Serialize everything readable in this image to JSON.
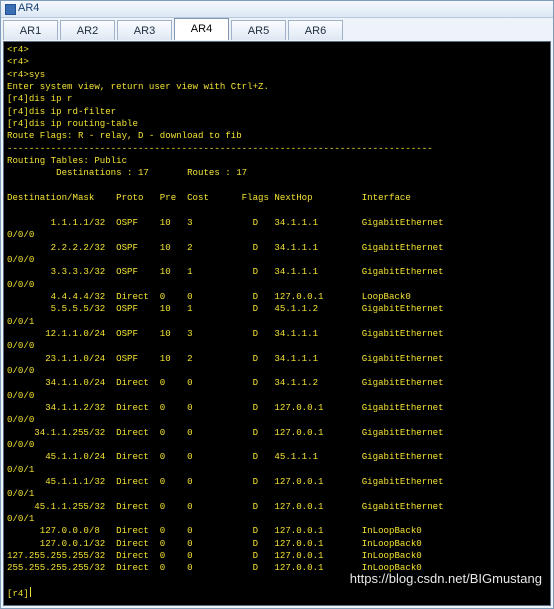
{
  "window": {
    "title": "AR4"
  },
  "tabs": [
    {
      "label": "AR1",
      "active": false
    },
    {
      "label": "AR2",
      "active": false
    },
    {
      "label": "AR3",
      "active": false
    },
    {
      "label": "AR4",
      "active": true
    },
    {
      "label": "AR5",
      "active": false
    },
    {
      "label": "AR6",
      "active": false
    }
  ],
  "terminal": {
    "text_color": "#f2e233",
    "background": "#000000",
    "lines": [
      "<r4>",
      "<r4>",
      "<r4>sys",
      "Enter system view, return user view with Ctrl+Z.",
      "[r4]dis ip r",
      "[r4]dis ip rd-filter",
      "[r4]dis ip routing-table",
      "Route Flags: R - relay, D - download to fib",
      "------------------------------------------------------------------------------",
      "Routing Tables: Public",
      "         Destinations : 17       Routes : 17",
      "",
      "Destination/Mask    Proto   Pre  Cost      Flags NextHop         Interface",
      "",
      "        1.1.1.1/32  OSPF    10   3           D   34.1.1.1        GigabitEthernet",
      "0/0/0",
      "        2.2.2.2/32  OSPF    10   2           D   34.1.1.1        GigabitEthernet",
      "0/0/0",
      "        3.3.3.3/32  OSPF    10   1           D   34.1.1.1        GigabitEthernet",
      "0/0/0",
      "        4.4.4.4/32  Direct  0    0           D   127.0.0.1       LoopBack0",
      "        5.5.5.5/32  OSPF    10   1           D   45.1.1.2        GigabitEthernet",
      "0/0/1",
      "       12.1.1.0/24  OSPF    10   3           D   34.1.1.1        GigabitEthernet",
      "0/0/0",
      "       23.1.1.0/24  OSPF    10   2           D   34.1.1.1        GigabitEthernet",
      "0/0/0",
      "       34.1.1.0/24  Direct  0    0           D   34.1.1.2        GigabitEthernet",
      "0/0/0",
      "       34.1.1.2/32  Direct  0    0           D   127.0.0.1       GigabitEthernet",
      "0/0/0",
      "     34.1.1.255/32  Direct  0    0           D   127.0.0.1       GigabitEthernet",
      "0/0/0",
      "       45.1.1.0/24  Direct  0    0           D   45.1.1.1        GigabitEthernet",
      "0/0/1",
      "       45.1.1.1/32  Direct  0    0           D   127.0.0.1       GigabitEthernet",
      "0/0/1",
      "     45.1.1.255/32  Direct  0    0           D   127.0.0.1       GigabitEthernet",
      "0/0/1",
      "      127.0.0.0/8   Direct  0    0           D   127.0.0.1       InLoopBack0",
      "      127.0.0.1/32  Direct  0    0           D   127.0.0.1       InLoopBack0",
      "127.255.255.255/32  Direct  0    0           D   127.0.0.1       InLoopBack0",
      "255.255.255.255/32  Direct  0    0           D   127.0.0.1       InLoopBack0"
    ],
    "prompt": "[r4]"
  },
  "watermark": "https://blog.csdn.net/BIGmustang"
}
